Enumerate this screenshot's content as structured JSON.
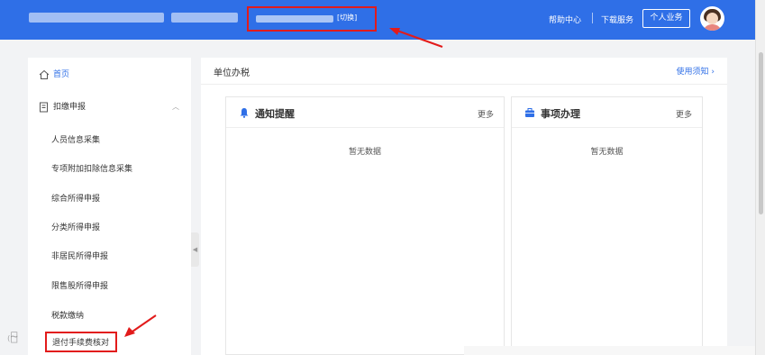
{
  "header": {
    "company_switch": {
      "switch_label": "[切换]"
    },
    "nav": {
      "help_label": "帮助中心",
      "download_label": "下载服务",
      "personal_label": "个人业务"
    }
  },
  "sidebar": {
    "home_label": "首页",
    "group_label": "扣缴申报",
    "items": [
      "人员信息采集",
      "专项附加扣除信息采集",
      "综合所得申报",
      "分类所得申报",
      "非居民所得申报",
      "限售股所得申报",
      "税款缴纳",
      "退付手续费核对"
    ]
  },
  "main": {
    "title": "单位办税",
    "usage_label": "使用须知",
    "cards": [
      {
        "title": "通知提醒",
        "more": "更多",
        "empty": "暂无数据"
      },
      {
        "title": "事项办理",
        "more": "更多",
        "empty": "暂无数据"
      }
    ]
  },
  "colors": {
    "header_bg": "#2f6fe7",
    "annotation_red": "#e21b1b",
    "link_blue": "#2f6fe7"
  }
}
